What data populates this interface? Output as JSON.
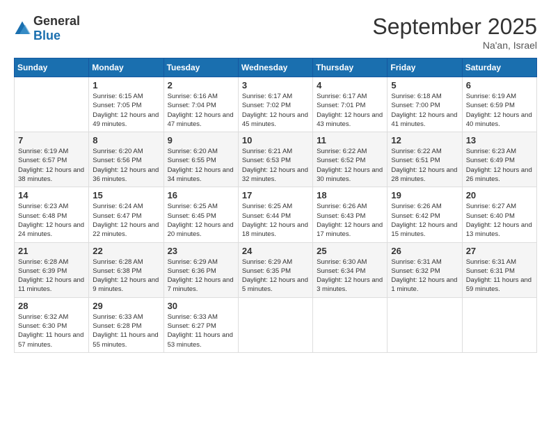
{
  "logo": {
    "text_general": "General",
    "text_blue": "Blue"
  },
  "title": "September 2025",
  "location": "Na'an, Israel",
  "days_of_week": [
    "Sunday",
    "Monday",
    "Tuesday",
    "Wednesday",
    "Thursday",
    "Friday",
    "Saturday"
  ],
  "weeks": [
    [
      {
        "day": "",
        "sunrise": "",
        "sunset": "",
        "daylight": ""
      },
      {
        "day": "1",
        "sunrise": "Sunrise: 6:15 AM",
        "sunset": "Sunset: 7:05 PM",
        "daylight": "Daylight: 12 hours and 49 minutes."
      },
      {
        "day": "2",
        "sunrise": "Sunrise: 6:16 AM",
        "sunset": "Sunset: 7:04 PM",
        "daylight": "Daylight: 12 hours and 47 minutes."
      },
      {
        "day": "3",
        "sunrise": "Sunrise: 6:17 AM",
        "sunset": "Sunset: 7:02 PM",
        "daylight": "Daylight: 12 hours and 45 minutes."
      },
      {
        "day": "4",
        "sunrise": "Sunrise: 6:17 AM",
        "sunset": "Sunset: 7:01 PM",
        "daylight": "Daylight: 12 hours and 43 minutes."
      },
      {
        "day": "5",
        "sunrise": "Sunrise: 6:18 AM",
        "sunset": "Sunset: 7:00 PM",
        "daylight": "Daylight: 12 hours and 41 minutes."
      },
      {
        "day": "6",
        "sunrise": "Sunrise: 6:19 AM",
        "sunset": "Sunset: 6:59 PM",
        "daylight": "Daylight: 12 hours and 40 minutes."
      }
    ],
    [
      {
        "day": "7",
        "sunrise": "Sunrise: 6:19 AM",
        "sunset": "Sunset: 6:57 PM",
        "daylight": "Daylight: 12 hours and 38 minutes."
      },
      {
        "day": "8",
        "sunrise": "Sunrise: 6:20 AM",
        "sunset": "Sunset: 6:56 PM",
        "daylight": "Daylight: 12 hours and 36 minutes."
      },
      {
        "day": "9",
        "sunrise": "Sunrise: 6:20 AM",
        "sunset": "Sunset: 6:55 PM",
        "daylight": "Daylight: 12 hours and 34 minutes."
      },
      {
        "day": "10",
        "sunrise": "Sunrise: 6:21 AM",
        "sunset": "Sunset: 6:53 PM",
        "daylight": "Daylight: 12 hours and 32 minutes."
      },
      {
        "day": "11",
        "sunrise": "Sunrise: 6:22 AM",
        "sunset": "Sunset: 6:52 PM",
        "daylight": "Daylight: 12 hours and 30 minutes."
      },
      {
        "day": "12",
        "sunrise": "Sunrise: 6:22 AM",
        "sunset": "Sunset: 6:51 PM",
        "daylight": "Daylight: 12 hours and 28 minutes."
      },
      {
        "day": "13",
        "sunrise": "Sunrise: 6:23 AM",
        "sunset": "Sunset: 6:49 PM",
        "daylight": "Daylight: 12 hours and 26 minutes."
      }
    ],
    [
      {
        "day": "14",
        "sunrise": "Sunrise: 6:23 AM",
        "sunset": "Sunset: 6:48 PM",
        "daylight": "Daylight: 12 hours and 24 minutes."
      },
      {
        "day": "15",
        "sunrise": "Sunrise: 6:24 AM",
        "sunset": "Sunset: 6:47 PM",
        "daylight": "Daylight: 12 hours and 22 minutes."
      },
      {
        "day": "16",
        "sunrise": "Sunrise: 6:25 AM",
        "sunset": "Sunset: 6:45 PM",
        "daylight": "Daylight: 12 hours and 20 minutes."
      },
      {
        "day": "17",
        "sunrise": "Sunrise: 6:25 AM",
        "sunset": "Sunset: 6:44 PM",
        "daylight": "Daylight: 12 hours and 18 minutes."
      },
      {
        "day": "18",
        "sunrise": "Sunrise: 6:26 AM",
        "sunset": "Sunset: 6:43 PM",
        "daylight": "Daylight: 12 hours and 17 minutes."
      },
      {
        "day": "19",
        "sunrise": "Sunrise: 6:26 AM",
        "sunset": "Sunset: 6:42 PM",
        "daylight": "Daylight: 12 hours and 15 minutes."
      },
      {
        "day": "20",
        "sunrise": "Sunrise: 6:27 AM",
        "sunset": "Sunset: 6:40 PM",
        "daylight": "Daylight: 12 hours and 13 minutes."
      }
    ],
    [
      {
        "day": "21",
        "sunrise": "Sunrise: 6:28 AM",
        "sunset": "Sunset: 6:39 PM",
        "daylight": "Daylight: 12 hours and 11 minutes."
      },
      {
        "day": "22",
        "sunrise": "Sunrise: 6:28 AM",
        "sunset": "Sunset: 6:38 PM",
        "daylight": "Daylight: 12 hours and 9 minutes."
      },
      {
        "day": "23",
        "sunrise": "Sunrise: 6:29 AM",
        "sunset": "Sunset: 6:36 PM",
        "daylight": "Daylight: 12 hours and 7 minutes."
      },
      {
        "day": "24",
        "sunrise": "Sunrise: 6:29 AM",
        "sunset": "Sunset: 6:35 PM",
        "daylight": "Daylight: 12 hours and 5 minutes."
      },
      {
        "day": "25",
        "sunrise": "Sunrise: 6:30 AM",
        "sunset": "Sunset: 6:34 PM",
        "daylight": "Daylight: 12 hours and 3 minutes."
      },
      {
        "day": "26",
        "sunrise": "Sunrise: 6:31 AM",
        "sunset": "Sunset: 6:32 PM",
        "daylight": "Daylight: 12 hours and 1 minute."
      },
      {
        "day": "27",
        "sunrise": "Sunrise: 6:31 AM",
        "sunset": "Sunset: 6:31 PM",
        "daylight": "Daylight: 11 hours and 59 minutes."
      }
    ],
    [
      {
        "day": "28",
        "sunrise": "Sunrise: 6:32 AM",
        "sunset": "Sunset: 6:30 PM",
        "daylight": "Daylight: 11 hours and 57 minutes."
      },
      {
        "day": "29",
        "sunrise": "Sunrise: 6:33 AM",
        "sunset": "Sunset: 6:28 PM",
        "daylight": "Daylight: 11 hours and 55 minutes."
      },
      {
        "day": "30",
        "sunrise": "Sunrise: 6:33 AM",
        "sunset": "Sunset: 6:27 PM",
        "daylight": "Daylight: 11 hours and 53 minutes."
      },
      {
        "day": "",
        "sunrise": "",
        "sunset": "",
        "daylight": ""
      },
      {
        "day": "",
        "sunrise": "",
        "sunset": "",
        "daylight": ""
      },
      {
        "day": "",
        "sunrise": "",
        "sunset": "",
        "daylight": ""
      },
      {
        "day": "",
        "sunrise": "",
        "sunset": "",
        "daylight": ""
      }
    ]
  ]
}
